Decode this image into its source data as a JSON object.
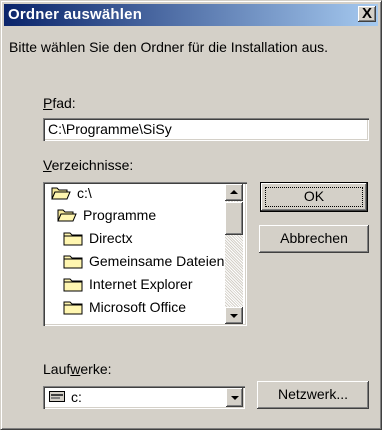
{
  "title": "Ordner auswählen",
  "close_glyph": "X",
  "instruction": "Bitte wählen Sie den Ordner für die Installation aus.",
  "path_label": {
    "accel": "P",
    "rest": "fad:"
  },
  "path_value": "C:\\Programme\\SiSy",
  "dirs_label": {
    "accel": "V",
    "rest": "erzeichnisse:"
  },
  "tree": [
    {
      "label": "c:\\",
      "icon": "open-folder-icon"
    },
    {
      "label": "Programme",
      "icon": "open-folder-icon"
    },
    {
      "label": "Directx",
      "icon": "folder-icon"
    },
    {
      "label": "Gemeinsame Dateien",
      "icon": "folder-icon"
    },
    {
      "label": "Internet Explorer",
      "icon": "folder-icon"
    },
    {
      "label": "Microsoft Office",
      "icon": "folder-icon"
    }
  ],
  "ok_label": "OK",
  "cancel_label": "Abbrechen",
  "drives_label": {
    "pre": "Lauf",
    "accel": "w",
    "rest": "erke:"
  },
  "drive_value": "c:",
  "network_label": "Netzwerk..."
}
